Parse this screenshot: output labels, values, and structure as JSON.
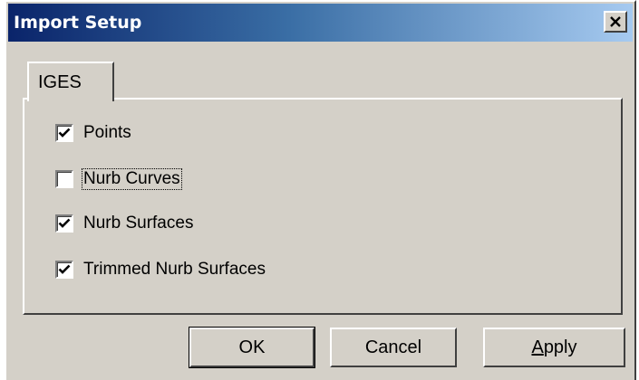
{
  "window": {
    "title": "Import Setup",
    "close_icon": "close-icon"
  },
  "tabs": [
    {
      "label": "IGES",
      "active": true
    }
  ],
  "options": [
    {
      "label": "Points",
      "checked": true
    },
    {
      "label": "Nurb Curves",
      "checked": false,
      "focused": true
    },
    {
      "label": "Nurb Surfaces",
      "checked": true
    },
    {
      "label": "Trimmed Nurb Surfaces",
      "checked": true
    }
  ],
  "buttons": {
    "ok_label": "OK",
    "cancel_label": "Cancel",
    "apply_mnemonic": "A",
    "apply_rest": "pply"
  },
  "colors": {
    "face": "#d4d0c8",
    "title_start": "#0a246a",
    "title_end": "#a6caf0"
  }
}
